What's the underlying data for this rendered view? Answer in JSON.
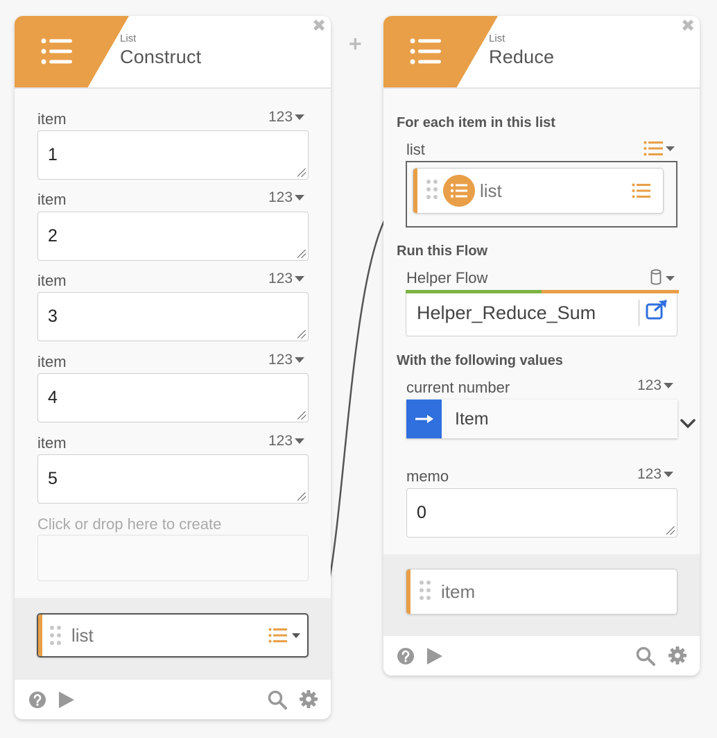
{
  "add_button": {
    "label": "+"
  },
  "construct": {
    "category": "List",
    "title": "Construct",
    "close": "✖",
    "items": [
      {
        "label": "item",
        "type": "123",
        "value": "1"
      },
      {
        "label": "item",
        "type": "123",
        "value": "2"
      },
      {
        "label": "item",
        "type": "123",
        "value": "3"
      },
      {
        "label": "item",
        "type": "123",
        "value": "4"
      },
      {
        "label": "item",
        "type": "123",
        "value": "5"
      }
    ],
    "create_placeholder": "Click or drop here to create",
    "output": {
      "label": "list"
    }
  },
  "reduce": {
    "category": "List",
    "title": "Reduce",
    "close": "✖",
    "section_each": "For each item in this list",
    "list_field": {
      "label": "list",
      "value": "list"
    },
    "section_run": "Run this Flow",
    "helper_flow": {
      "label": "Helper Flow",
      "value": "Helper_Reduce_Sum"
    },
    "section_values": "With the following values",
    "current_number": {
      "label": "current number",
      "type": "123",
      "value": "Item"
    },
    "memo": {
      "label": "memo",
      "type": "123",
      "value": "0"
    },
    "output": {
      "label": "item"
    }
  },
  "colors": {
    "accent": "#e89f48",
    "link_blue": "#2f6fde",
    "green": "#7cb342"
  },
  "icons": [
    "list-icon",
    "close-icon",
    "help-icon",
    "play-icon",
    "search-icon",
    "gear-icon",
    "database-icon",
    "external-link-icon",
    "arrow-right-icon",
    "chevron-down-icon"
  ]
}
